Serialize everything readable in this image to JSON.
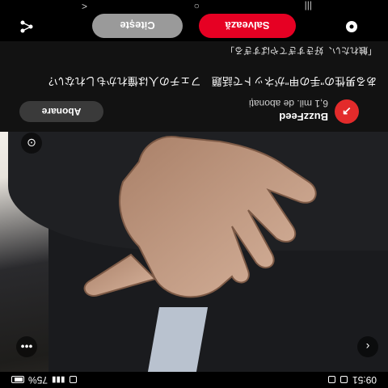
{
  "status_bar": {
    "time": "09:51",
    "battery": "75%"
  },
  "channel": {
    "name": "BuzzFeed",
    "subscribers": "6,1 mil. de abonați",
    "subscribe_label": "Abonare"
  },
  "post": {
    "title": "ある男性の\"手の甲\"がネットで話題　フェチの人は憧れかもしれない？",
    "subtitle": "「触れたい、好きすぎてやばすぎる」"
  },
  "actions": {
    "read_label": "Citește",
    "save_label": "Salvează"
  },
  "nav": {
    "recents": "|||",
    "home": "○",
    "back": "<"
  },
  "colors": {
    "accent_red": "#e60023",
    "grey_button": "#9a9a9a",
    "dark_bg": "#121212"
  },
  "icons": [
    "share-icon",
    "lens-search-icon",
    "more-dots-icon",
    "back-chevron-icon",
    "chat-bubble-icon"
  ]
}
